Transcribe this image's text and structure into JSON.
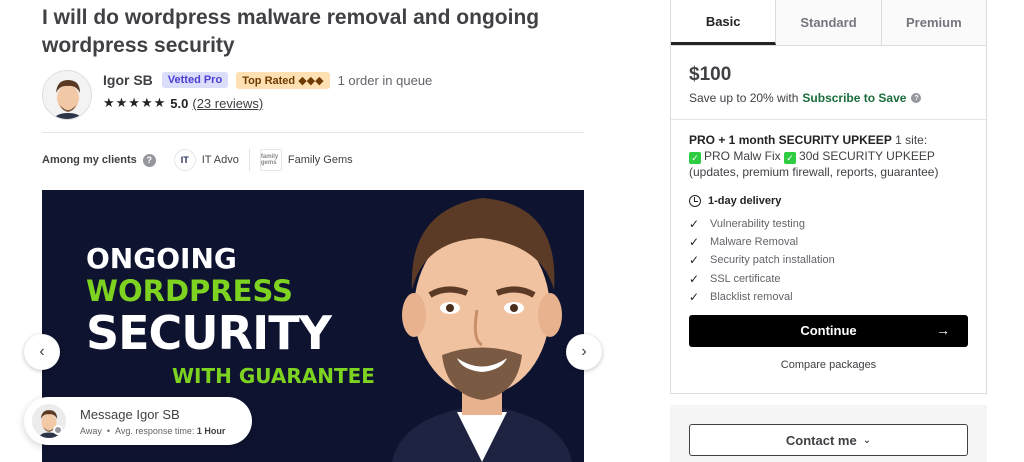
{
  "gig": {
    "title": "I will do wordpress malware removal and ongoing wordpress security"
  },
  "seller": {
    "name": "Igor SB",
    "badge_vetted": "Vetted Pro",
    "badge_top": "Top Rated ◆◆◆",
    "queue": "1 order in queue",
    "stars": "★★★★★",
    "rating": "5.0",
    "reviews": "(23 reviews)"
  },
  "clients": {
    "label": "Among my clients",
    "items": [
      {
        "name": "IT Advo",
        "logo": "IT"
      },
      {
        "name": "Family Gems",
        "logo": "family gems"
      }
    ]
  },
  "hero": {
    "line1": "ONGOING",
    "line2": "WORDPRESS",
    "line3": "SECURITY",
    "line4": "WITH GUARANTEE"
  },
  "message": {
    "title": "Message Igor SB",
    "status": "Away",
    "response_label": "Avg. response time:",
    "response_value": "1 Hour"
  },
  "package": {
    "tabs": [
      "Basic",
      "Standard",
      "Premium"
    ],
    "active_tab": "Basic",
    "price": "$100",
    "save_prefix": "Save up to 20% with",
    "save_link": "Subscribe to Save",
    "desc_title": "PRO + 1 month SECURITY UPKEEP",
    "desc_suffix": "1 site:",
    "desc_item1": "PRO Malw Fix",
    "desc_item2": "30d SECURITY UPKEEP",
    "desc_rest": "(updates, premium firewall, reports, guarantee)",
    "delivery": "1-day delivery",
    "features": [
      "Vulnerability testing",
      "Malware Removal",
      "Security patch installation",
      "SSL certificate",
      "Blacklist removal"
    ],
    "continue": "Continue",
    "compare": "Compare packages"
  },
  "contact": {
    "label": "Contact me"
  },
  "icons": {
    "help": "?",
    "info": "?",
    "prev": "‹",
    "next": "›",
    "arrow": "→",
    "check": "✓",
    "chevron": "⌄"
  }
}
